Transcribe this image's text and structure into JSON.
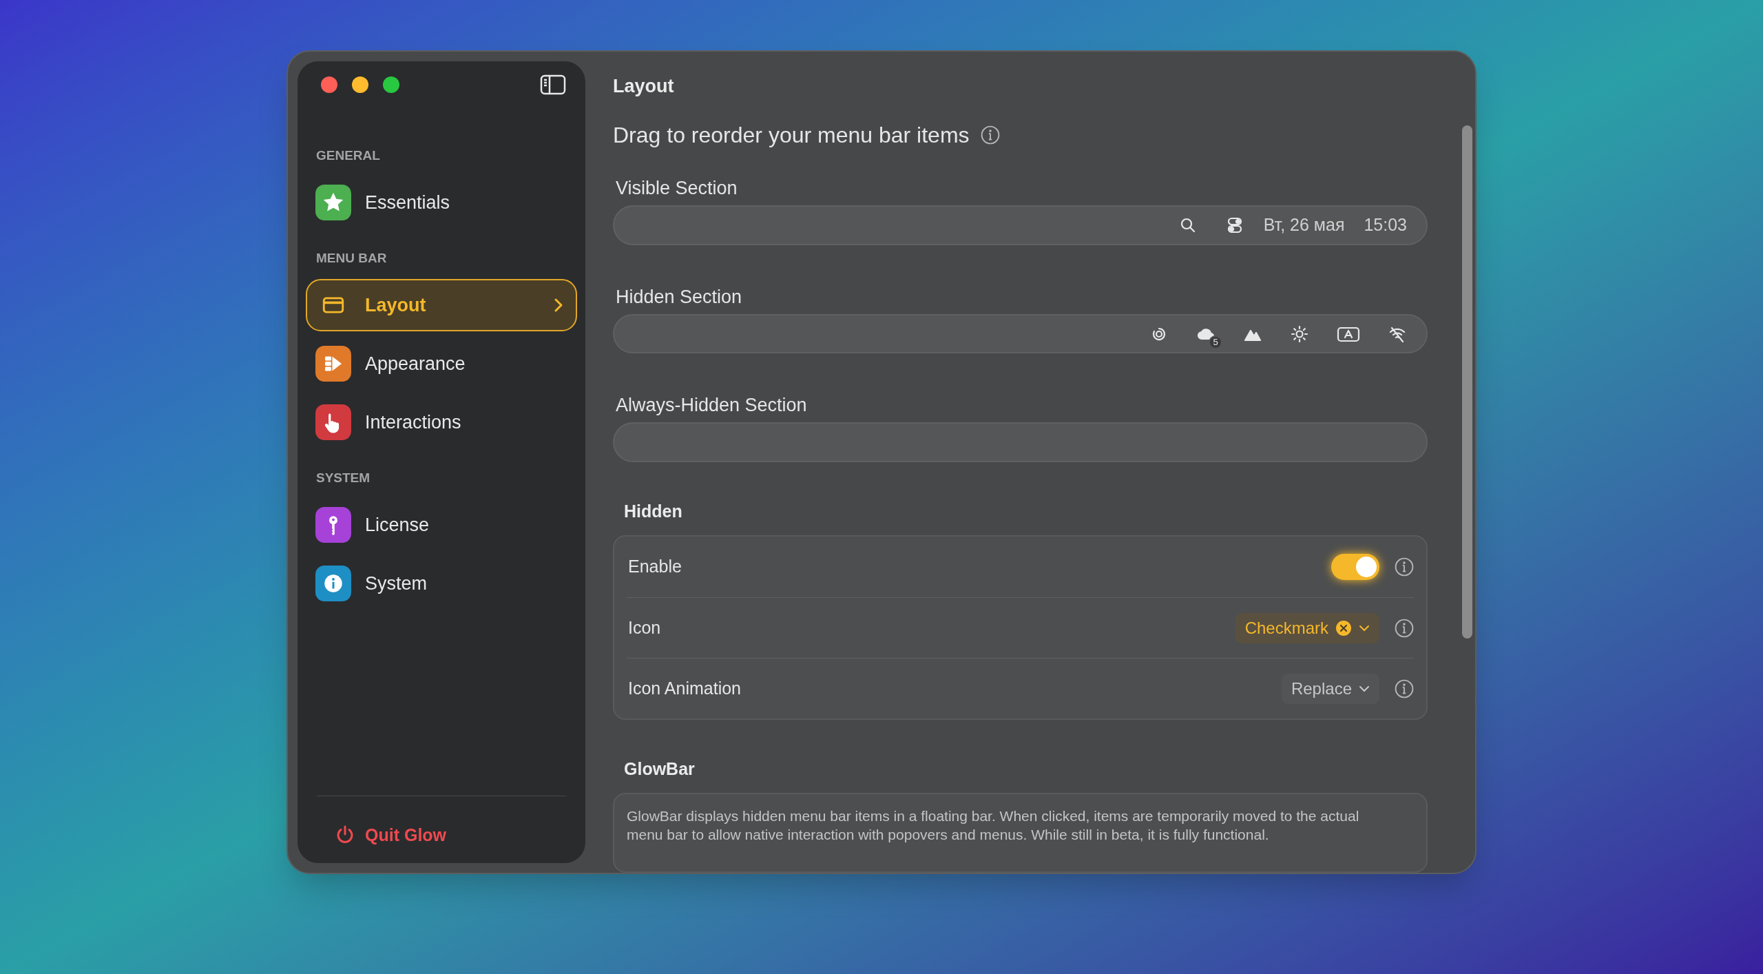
{
  "sidebar": {
    "sections": [
      {
        "heading": "GENERAL",
        "items": [
          {
            "label": "Essentials",
            "selected": false,
            "color": "#4caf50"
          }
        ]
      },
      {
        "heading": "MENU BAR",
        "items": [
          {
            "label": "Layout",
            "selected": true,
            "color": "#f5b82a"
          },
          {
            "label": "Appearance",
            "selected": false,
            "color": "#e07a2a"
          },
          {
            "label": "Interactions",
            "selected": false,
            "color": "#d13a3f"
          }
        ]
      },
      {
        "heading": "SYSTEM",
        "items": [
          {
            "label": "License",
            "selected": false,
            "color": "#a642d8"
          },
          {
            "label": "System",
            "selected": false,
            "color": "#1e8fc4"
          }
        ]
      }
    ],
    "quit": "Quit Glow"
  },
  "content": {
    "title": "Layout",
    "intro": "Drag to reorder your menu bar items",
    "sections": [
      {
        "label": "Visible Section",
        "items": [
          {
            "kind": "icon"
          },
          {
            "kind": "icon"
          },
          {
            "kind": "text",
            "text": "Вт, 26 мая"
          },
          {
            "kind": "text",
            "text": "15:03"
          }
        ]
      },
      {
        "label": "Hidden Section",
        "items": [
          {
            "kind": "icon"
          },
          {
            "kind": "icon",
            "badge": "5"
          },
          {
            "kind": "icon"
          },
          {
            "kind": "icon"
          },
          {
            "kind": "icon"
          },
          {
            "kind": "icon"
          }
        ]
      },
      {
        "label": "Always-Hidden Section"
      }
    ],
    "groups": [
      {
        "heading": "Hidden",
        "rows": [
          {
            "kind": "toggle",
            "label": "Enable",
            "on": true
          },
          {
            "kind": "select",
            "label": "Icon",
            "value": "Checkmark",
            "modified": true
          },
          {
            "kind": "select",
            "label": "Icon Animation",
            "value": "Replace",
            "modified": false
          }
        ]
      },
      {
        "heading": "GlowBar",
        "description": "GlowBar displays hidden menu bar items in a floating bar. When clicked, items are temporarily moved to the actual menu bar to allow native interaction with popovers and menus. While still in beta, it is fully functional."
      }
    ]
  }
}
